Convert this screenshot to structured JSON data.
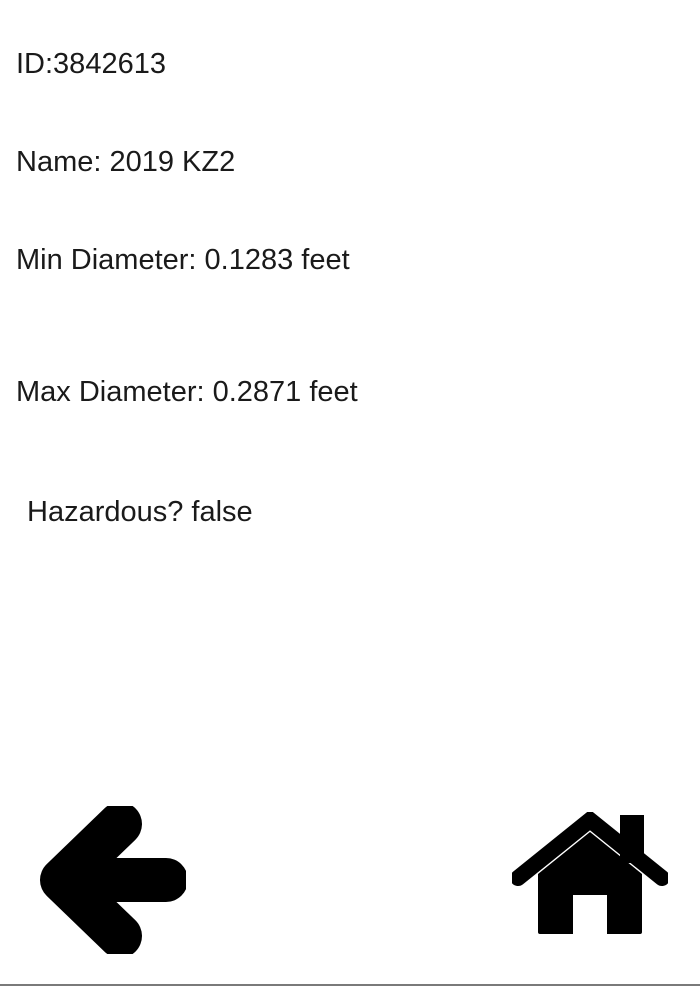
{
  "asteroid": {
    "id_text": "ID:3842613",
    "name_text": "Name: 2019 KZ2",
    "min_diameter_text": "Min Diameter: 0.1283 feet",
    "max_diameter_text": "Max Diameter: 0.2871 feet",
    "hazardous_text": "Hazardous? false"
  },
  "nav": {
    "back_icon": "arrow-left-icon",
    "home_icon": "home-icon"
  },
  "colors": {
    "background": "#ffffff",
    "text": "#1a1a1a",
    "icon": "#000000"
  }
}
